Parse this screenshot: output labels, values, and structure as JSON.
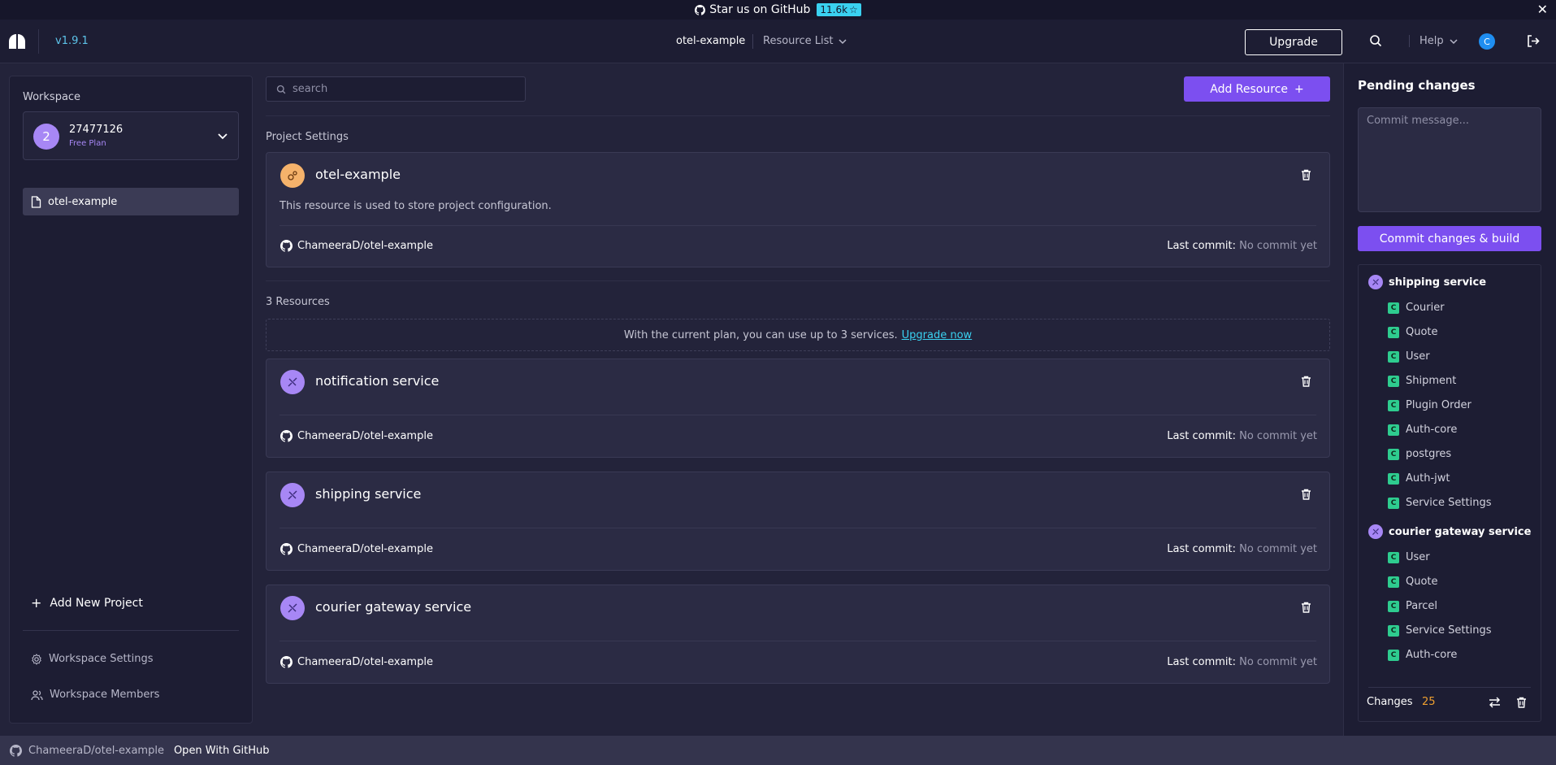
{
  "banner": {
    "text": "Star us on GitHub",
    "stars": "11.6k"
  },
  "header": {
    "version": "v1.9.1",
    "project": "otel-example",
    "resource_list": "Resource List",
    "upgrade": "Upgrade",
    "help": "Help",
    "avatar": "C"
  },
  "sidebar": {
    "workspace_label": "Workspace",
    "workspace_avatar": "2",
    "workspace_id": "27477126",
    "workspace_plan": "Free Plan",
    "projects": [
      {
        "label": "otel-example"
      }
    ],
    "add_project": "Add New Project",
    "settings": "Workspace Settings",
    "members": "Workspace Members"
  },
  "main": {
    "search_placeholder": "search",
    "add_resource": "Add Resource",
    "project_settings_label": "Project Settings",
    "project_card": {
      "title": "otel-example",
      "description": "This resource is used to store project configuration.",
      "repo": "ChameeraD/otel-example",
      "last_commit_label": "Last commit:",
      "last_commit_value": "No commit yet"
    },
    "resources_count": "3 Resources",
    "plan_note": "With the current plan, you can use up to 3 services.",
    "plan_upgrade": "Upgrade now",
    "resources": [
      {
        "title": "notification service",
        "repo": "ChameeraD/otel-example",
        "last_commit_label": "Last commit:",
        "last_commit_value": "No commit yet"
      },
      {
        "title": "shipping service",
        "repo": "ChameeraD/otel-example",
        "last_commit_label": "Last commit:",
        "last_commit_value": "No commit yet"
      },
      {
        "title": "courier gateway service",
        "repo": "ChameeraD/otel-example",
        "last_commit_label": "Last commit:",
        "last_commit_value": "No commit yet"
      }
    ]
  },
  "pending": {
    "title": "Pending changes",
    "commit_placeholder": "Commit message...",
    "commit_button": "Commit changes & build",
    "groups": [
      {
        "service": "shipping service",
        "items": [
          "Courier",
          "Quote",
          "User",
          "Shipment",
          "Plugin Order",
          "Auth-core",
          "postgres",
          "Auth-jwt",
          "Service Settings"
        ]
      },
      {
        "service": "courier gateway service",
        "items": [
          "User",
          "Quote",
          "Parcel",
          "Service Settings",
          "Auth-core"
        ]
      }
    ],
    "change_badge": "C",
    "changes_label": "Changes",
    "changes_count": "25"
  },
  "footer": {
    "repo": "ChameeraD/otel-example",
    "open": "Open With GitHub"
  },
  "colors": {
    "accent": "#7c4ff0",
    "service_icon": "#a787f5",
    "project_icon": "#f5b26b",
    "link": "#3ad1f0",
    "change_badge": "#2ecc8f"
  }
}
